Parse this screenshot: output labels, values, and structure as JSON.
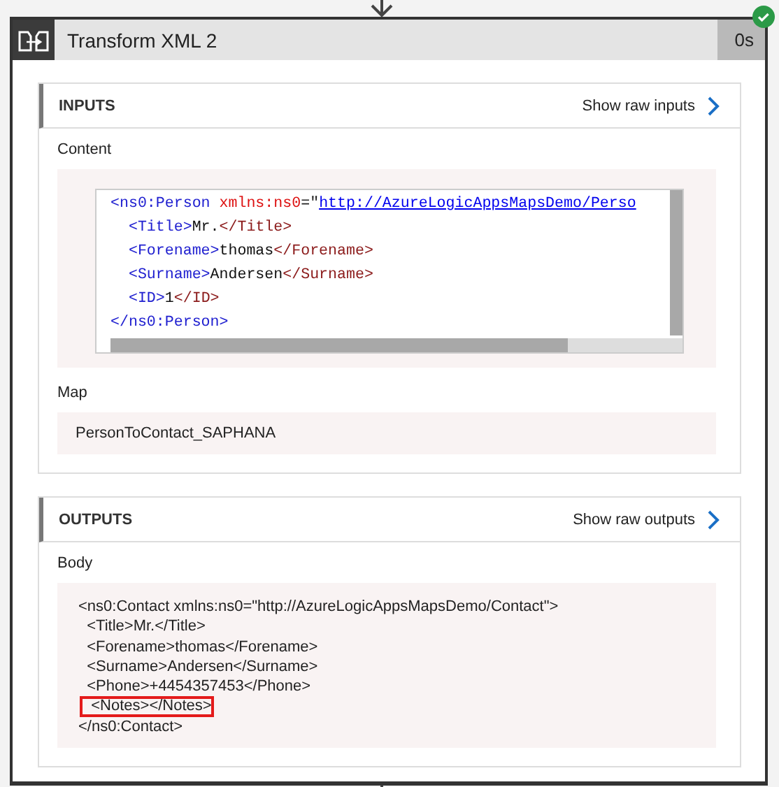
{
  "action": {
    "title": "Transform XML 2",
    "duration": "0s",
    "succeeded": true
  },
  "inputs": {
    "heading": "INPUTS",
    "link": "Show raw inputs",
    "content_label": "Content",
    "content_lines": [
      [
        {
          "kind": "tag",
          "text": "<ns0:Person "
        },
        {
          "kind": "attr",
          "text": "xmlns:ns0"
        },
        {
          "kind": "punct",
          "text": "=\""
        },
        {
          "kind": "link",
          "text": "http://AzureLogicAppsMapsDemo/Perso"
        }
      ],
      [
        {
          "kind": "tag",
          "text": "  <Title>"
        },
        {
          "kind": "text",
          "text": "Mr."
        },
        {
          "kind": "tag",
          "text": "</Title>"
        }
      ],
      [
        {
          "kind": "tag",
          "text": "  <Forename>"
        },
        {
          "kind": "text",
          "text": "thomas"
        },
        {
          "kind": "tag",
          "text": "</Forename>"
        }
      ],
      [
        {
          "kind": "tag",
          "text": "  <Surname>"
        },
        {
          "kind": "text",
          "text": "Andersen"
        },
        {
          "kind": "tag",
          "text": "</Surname>"
        }
      ],
      [
        {
          "kind": "tag",
          "text": "  <ID>"
        },
        {
          "kind": "text",
          "text": "1"
        },
        {
          "kind": "tag",
          "text": "</ID>"
        }
      ],
      [
        {
          "kind": "tag",
          "text": "</ns0:Person>"
        }
      ]
    ],
    "map_label": "Map",
    "map_value": "PersonToContact_SAPHANA"
  },
  "outputs": {
    "heading": "OUTPUTS",
    "link": "Show raw outputs",
    "body_label": "Body",
    "body_lines": [
      {
        "text": "<ns0:Contact xmlns:ns0=\"http://AzureLogicAppsMapsDemo/Contact\">",
        "highlighted": false
      },
      {
        "text": "  <Title>Mr.</Title>",
        "highlighted": false
      },
      {
        "text": "  <Forename>thomas</Forename>",
        "highlighted": false
      },
      {
        "text": "  <Surname>Andersen</Surname>",
        "highlighted": false
      },
      {
        "text": "  <Phone>+4454357453</Phone>",
        "highlighted": false
      },
      {
        "text": "  <Notes></Notes>",
        "highlighted": true
      },
      {
        "text": "</ns0:Contact>",
        "highlighted": false
      }
    ]
  }
}
